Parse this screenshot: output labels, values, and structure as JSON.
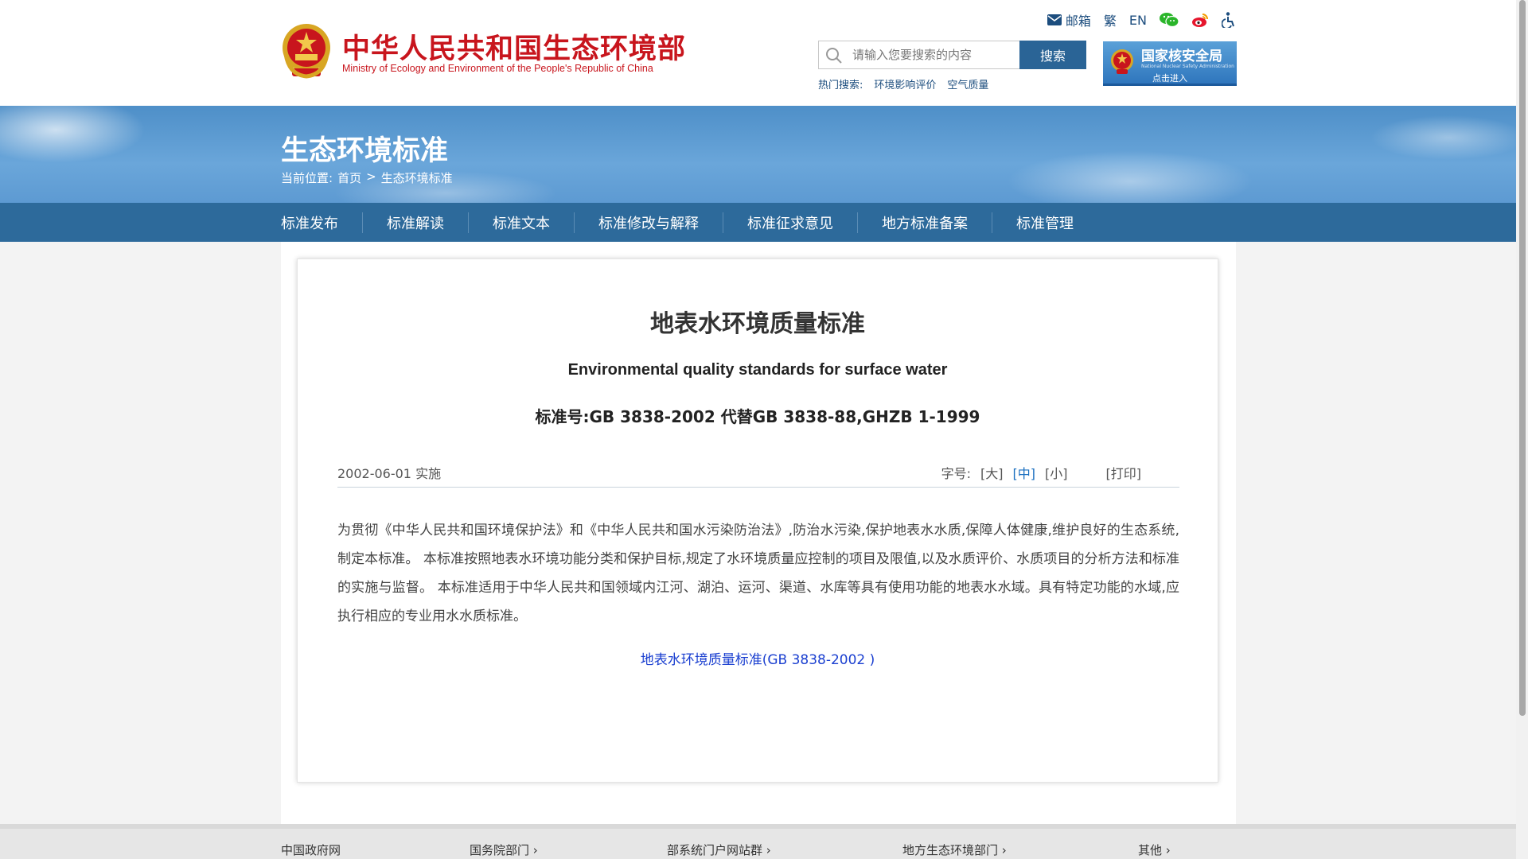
{
  "header": {
    "logo_cn": "中华人民共和国生态环境部",
    "logo_en": "Ministry of Ecology and Environment of the People's Republic of China",
    "top_links": {
      "mail_label": "邮箱",
      "traditional_label": "繁",
      "english_label": "EN"
    },
    "search": {
      "placeholder": "请输入您要搜索的内容",
      "button_label": "搜索",
      "hot_label": "热门搜索:",
      "hot_terms": [
        "环境影响评价",
        "空气质量"
      ]
    },
    "nnsa": {
      "cn": "国家核安全局",
      "en": "National Nuclear Safety Administration",
      "enter": "点击进入"
    }
  },
  "banner": {
    "title": "生态环境标准",
    "breadcrumb": {
      "prefix": "当前位置:",
      "home": "首页",
      "separator": ">",
      "current": "生态环境标准"
    }
  },
  "nav": {
    "items": [
      "标准发布",
      "标准解读",
      "标准文本",
      "标准修改与解释",
      "标准征求意见",
      "地方标准备案",
      "标准管理"
    ]
  },
  "document": {
    "title": "地表水环境质量标准",
    "title_en": "Environmental quality standards for surface water",
    "standard_no": "标准号:GB 3838-2002 代替GB 3838-88,GHZB 1-1999",
    "date": "2002-06-01 实施",
    "font_label": "字号:",
    "font_large": "[大]",
    "font_medium": "[中]",
    "font_small": "[小]",
    "print": "[打印]",
    "body": "为贯彻《中华人民共和国环境保护法》和《中华人民共和国水污染防治法》,防治水污染,保护地表水水质,保障人体健康,维护良好的生态系统,制定本标准。 本标准按照地表水环境功能分类和保护目标,规定了水环境质量应控制的项目及限值,以及水质评价、水质项目的分析方法和标准的实施与监督。 本标准适用于中华人民共和国领域内江河、湖泊、运河、渠道、水库等具有使用功能的地表水水域。具有特定功能的水域,应执行相应的专业用水水质标准。",
    "link": "地表水环境质量标准(GB 3838-2002 )"
  },
  "footer": {
    "items": [
      "中国政府网",
      "国务院部门 ›",
      "部系统门户网站群 ›",
      "地方生态环境部门 ›",
      "其他 ›"
    ]
  },
  "colors": {
    "brand_red": "#c8151d",
    "nav_blue": "#2d6a9b",
    "link_blue": "#1a3fd0"
  },
  "icons": [
    "mail-icon",
    "wechat-icon",
    "weibo-icon",
    "accessibility-icon",
    "search-icon",
    "national-emblem-icon"
  ]
}
